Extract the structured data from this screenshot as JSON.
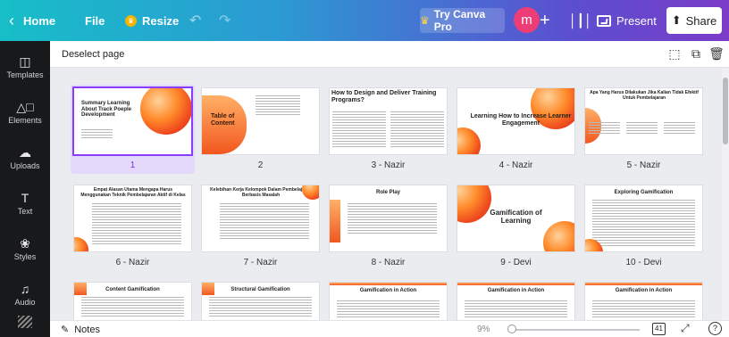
{
  "topbar": {
    "home_label": "Home",
    "file_label": "File",
    "resize_label": "Resize",
    "try_label": "Try Canva Pro",
    "avatar_letter": "m",
    "present_label": "Present",
    "share_label": "Share",
    "gradient_colors": [
      "#17bec8",
      "#2c9ad3",
      "#5b4fd0",
      "#7b3cc8"
    ]
  },
  "sidebar": {
    "items": [
      {
        "label": "Templates",
        "icon": "templates-icon"
      },
      {
        "label": "Elements",
        "icon": "elements-icon"
      },
      {
        "label": "Uploads",
        "icon": "uploads-icon"
      },
      {
        "label": "Text",
        "icon": "text-icon"
      },
      {
        "label": "Styles",
        "icon": "styles-icon"
      },
      {
        "label": "Audio",
        "icon": "audio-icon"
      }
    ]
  },
  "header": {
    "deselect_label": "Deselect page"
  },
  "pages": [
    {
      "label": "1",
      "title": "Summary Learning About Track Poeple Development",
      "selected": true
    },
    {
      "label": "2",
      "title": "Table of Content"
    },
    {
      "label": "3 - Nazir",
      "title": "How to Design and Deliver Training Programs?"
    },
    {
      "label": "4 - Nazir",
      "title": "Learning How to Increase Learner Engagement"
    },
    {
      "label": "5 - Nazir",
      "title": "Apa Yang Harus Dilakukan Jika Kalian Tidak Efektif Untuk Pembelajaran"
    },
    {
      "label": "6 - Nazir",
      "title": "Empat Alasan Utama Mengapa Harus Menggunakan Teknik Pembelajaran Aktif di Kelas"
    },
    {
      "label": "7 - Nazir",
      "title": "Kelebihan Kerja Kelompok Dalam Pembelajaran Berbasis Masalah"
    },
    {
      "label": "8 - Nazir",
      "title": "Role Play"
    },
    {
      "label": "9 - Devi",
      "title": "Gamification of Learning"
    },
    {
      "label": "10 - Devi",
      "title": "Exploring Gamification"
    },
    {
      "label": "",
      "title": "Content Gamification"
    },
    {
      "label": "",
      "title": "Structural Gamification"
    },
    {
      "label": "",
      "title": "Gamification in Action"
    },
    {
      "label": "",
      "title": "Gamification in Action"
    },
    {
      "label": "",
      "title": "Gamification in Action"
    }
  ],
  "bottombar": {
    "notes_label": "Notes",
    "zoom_label": "9%",
    "page_count": "41",
    "help_label": "?"
  },
  "colors": {
    "accent": "#8b3dff",
    "sidebar_bg": "#18191b",
    "canvas_bg": "#ebecf0",
    "thumb_orange": "#f2571f"
  }
}
